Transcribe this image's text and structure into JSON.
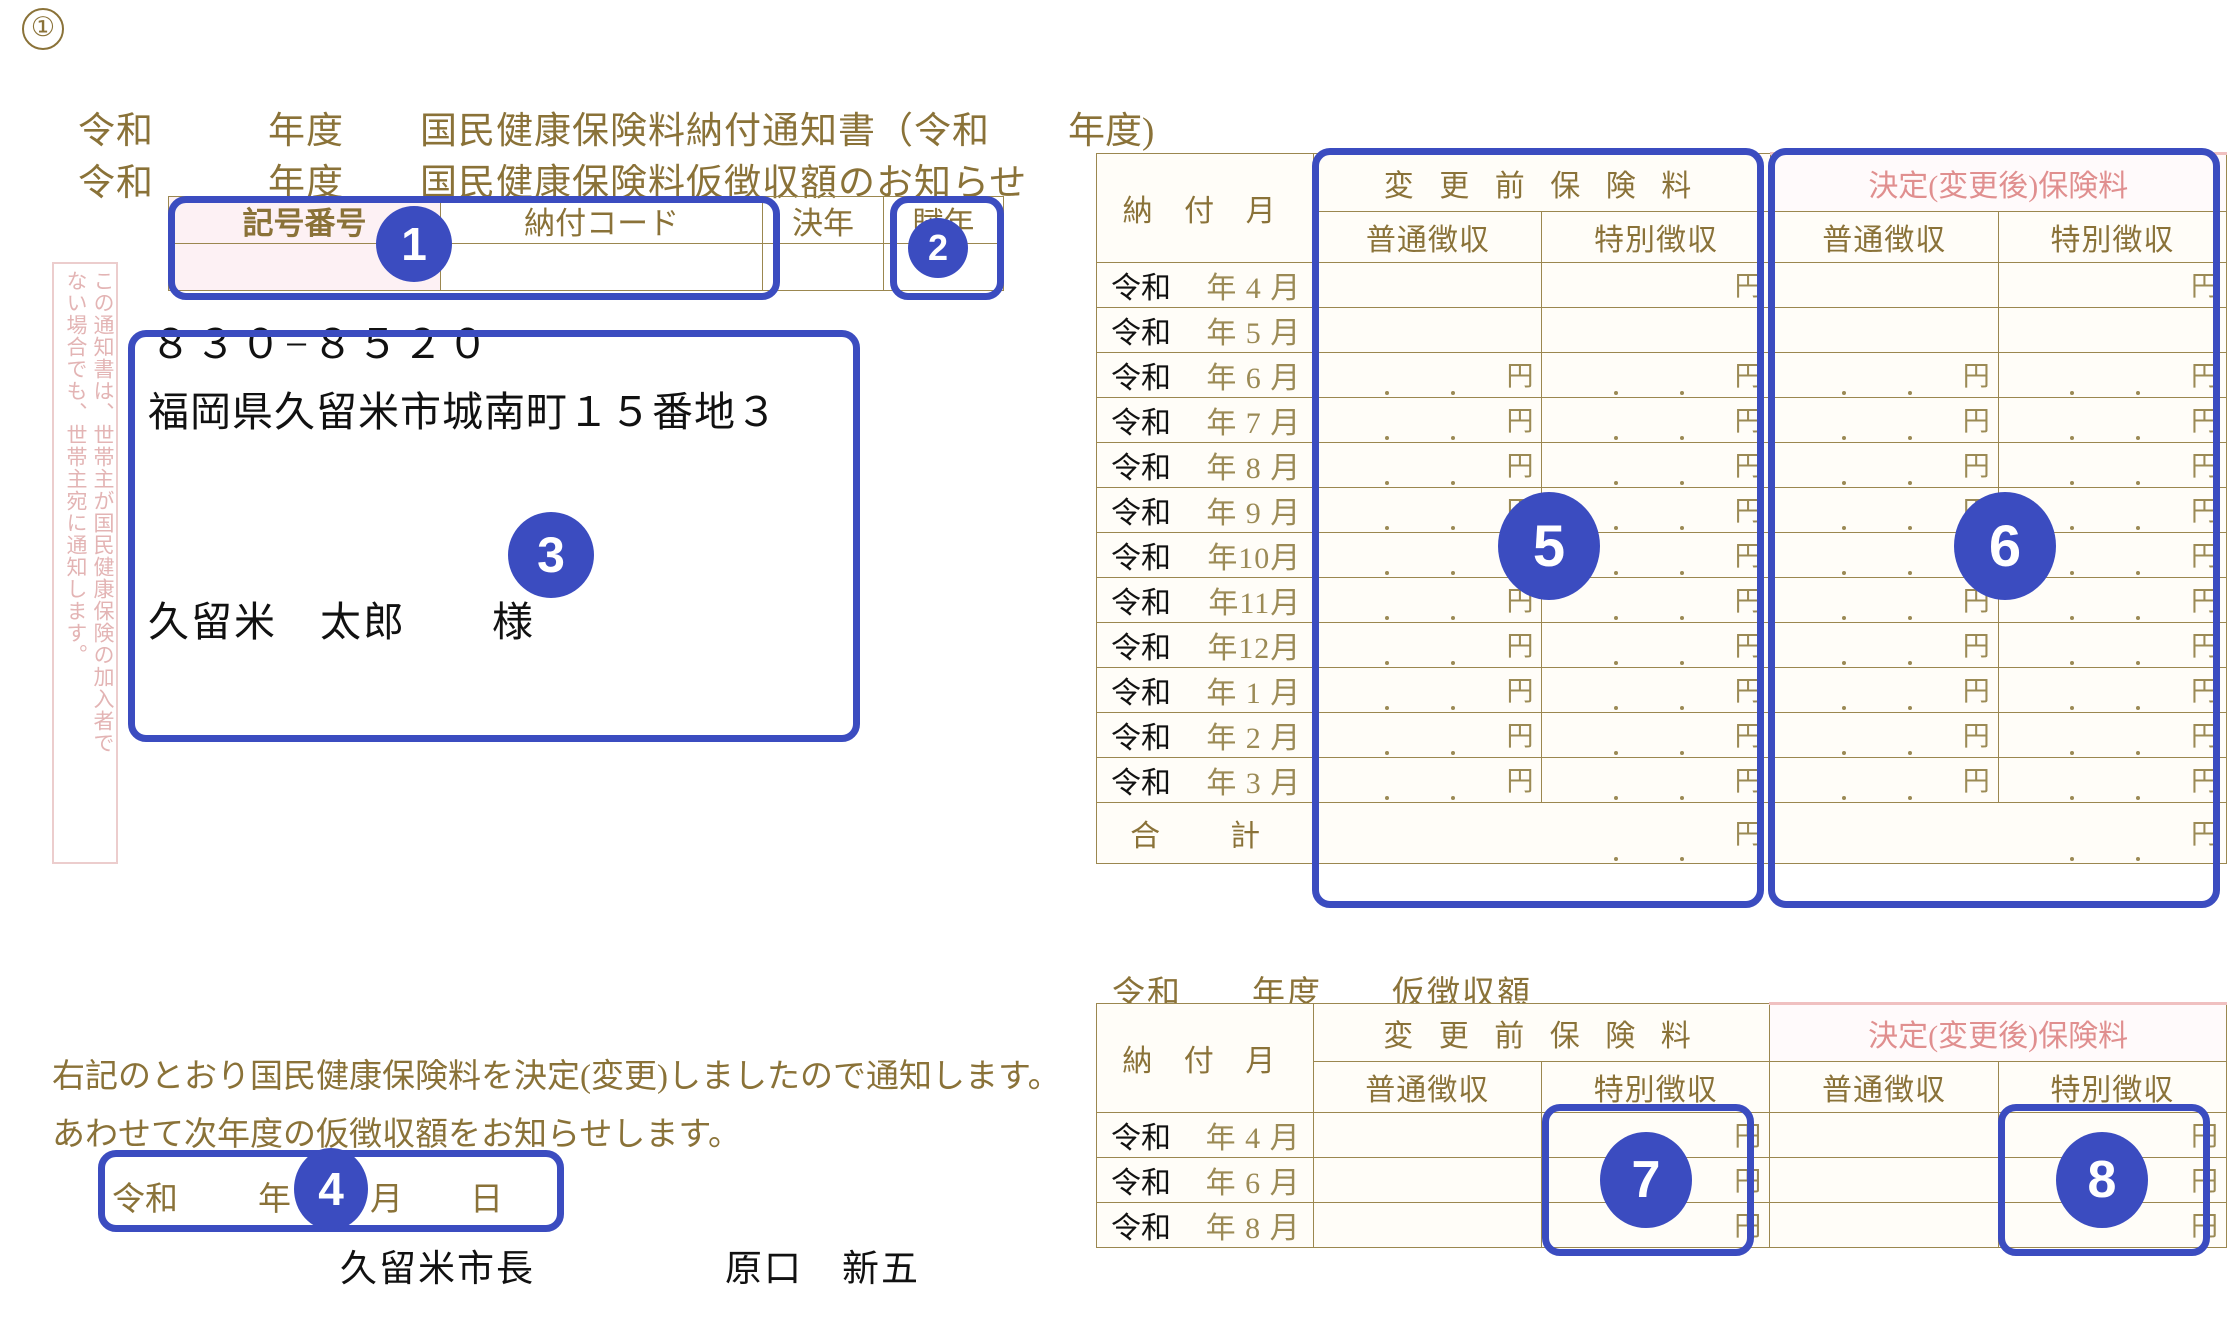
{
  "page": {
    "item_marker": "①"
  },
  "header": {
    "line1": "令和　　　年度　　国民健康保険料納付通知書（令和",
    "line1_right": "年度)",
    "line2": "令和　　　年度　　国民健康保険料仮徴収額のお知らせ"
  },
  "code_table": {
    "headers": [
      "記号番号",
      "納付コード",
      "決年",
      "賦年"
    ],
    "values": [
      "",
      "",
      "",
      ""
    ]
  },
  "vertical_note": {
    "column_right": "この通知書は、世帯主が国民健康保険の加入者で",
    "column_left": "ない場合でも、世帯主宛に通知します。"
  },
  "address": {
    "zip": "８３０−８５２０",
    "street": "福岡県久留米市城南町１５番地３",
    "person": "久留米　太郎　　様"
  },
  "statement": {
    "line1": "右記のとおり国民健康保険料を決定(変更)しましたので通知します。",
    "line2": "あわせて次年度の仮徴収額をお知らせします。",
    "date": {
      "era": "令和",
      "year_label": "年",
      "month_label": "月",
      "day_label": "日"
    },
    "issuer_title": "久留米市長",
    "issuer_name": "原口　新五"
  },
  "main_table": {
    "month_header": "納 付 月",
    "group_before": "変 更 前 保 険 料",
    "group_after": "決定(変更後)保険料",
    "sub_ordinary": "普通徴収",
    "sub_special": "特別徴収",
    "era": "令和",
    "yen": "円",
    "rows": [
      {
        "era": "令和",
        "month": "年 4 月",
        "before_ord": "",
        "before_spc": "",
        "after_ord": "",
        "after_spc": "",
        "show_dots_before_ord": false,
        "show_yen_before_ord": false,
        "show_yen_before_spc": true,
        "show_yen_after_ord": false,
        "show_yen_after_spc": true
      },
      {
        "era": "令和",
        "month": "年 5 月",
        "before_ord": "",
        "before_spc": "",
        "after_ord": "",
        "after_spc": "",
        "show_yen_before_spc": false,
        "show_yen_after_spc": false
      },
      {
        "era": "令和",
        "month": "年 6 月",
        "before_ord": "",
        "before_spc": "",
        "after_ord": "",
        "after_spc": ""
      },
      {
        "era": "令和",
        "month": "年 7 月",
        "before_ord": "",
        "before_spc": "",
        "after_ord": "",
        "after_spc": ""
      },
      {
        "era": "令和",
        "month": "年 8 月",
        "before_ord": "",
        "before_spc": "",
        "after_ord": "",
        "after_spc": ""
      },
      {
        "era": "令和",
        "month": "年 9 月",
        "before_ord": "",
        "before_spc": "",
        "after_ord": "",
        "after_spc": ""
      },
      {
        "era": "令和",
        "month": "年10月",
        "before_ord": "",
        "before_spc": "",
        "after_ord": "",
        "after_spc": ""
      },
      {
        "era": "令和",
        "month": "年11月",
        "before_ord": "",
        "before_spc": "",
        "after_ord": "",
        "after_spc": ""
      },
      {
        "era": "令和",
        "month": "年12月",
        "before_ord": "",
        "before_spc": "",
        "after_ord": "",
        "after_spc": ""
      },
      {
        "era": "令和",
        "month": "年 1 月",
        "before_ord": "",
        "before_spc": "",
        "after_ord": "",
        "after_spc": ""
      },
      {
        "era": "令和",
        "month": "年 2 月",
        "before_ord": "",
        "before_spc": "",
        "after_ord": "",
        "after_spc": ""
      },
      {
        "era": "令和",
        "month": "年 3 月",
        "before_ord": "",
        "before_spc": "",
        "after_ord": "",
        "after_spc": ""
      }
    ],
    "total_label": "合　計",
    "total_before": "",
    "total_after": ""
  },
  "sub_table": {
    "title": "令和　　年度　　仮徴収額",
    "month_header": "納 付 月",
    "group_before": "変 更 前 保 険 料",
    "group_after": "決定(変更後)保険料",
    "sub_ordinary": "普通徴収",
    "sub_special": "特別徴収",
    "yen": "円",
    "rows": [
      {
        "era": "令和",
        "month": "年 4 月",
        "before_ord": "",
        "before_spc": "",
        "after_ord": "",
        "after_spc": ""
      },
      {
        "era": "令和",
        "month": "年 6 月",
        "before_ord": "",
        "before_spc": "",
        "after_ord": "",
        "after_spc": ""
      },
      {
        "era": "令和",
        "month": "年 8 月",
        "before_ord": "",
        "before_spc": "",
        "after_ord": "",
        "after_spc": ""
      }
    ]
  },
  "annotations": [
    {
      "id": "1",
      "label": "1"
    },
    {
      "id": "2",
      "label": "2"
    },
    {
      "id": "3",
      "label": "3"
    },
    {
      "id": "4",
      "label": "4"
    },
    {
      "id": "5",
      "label": "5"
    },
    {
      "id": "6",
      "label": "6"
    },
    {
      "id": "7",
      "label": "7"
    },
    {
      "id": "8",
      "label": "8"
    }
  ],
  "colors": {
    "ink_gold": "#8a7238",
    "ink_pink": "#e08f8f",
    "annotation_blue": "#3b4cc0",
    "paper": "#ffffff"
  }
}
